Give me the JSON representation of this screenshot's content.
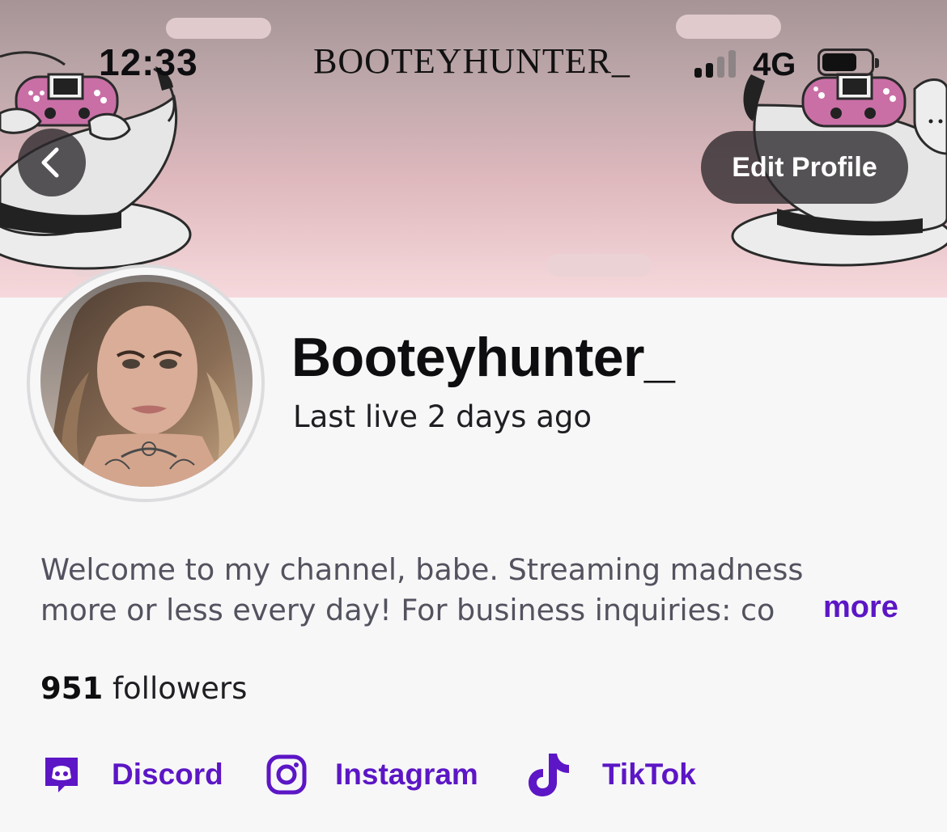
{
  "status_bar": {
    "time": "12:33",
    "title": "BOOTEYHUNTER_",
    "network": "4G",
    "signal_bars_active": 2,
    "signal_bars_total": 4
  },
  "header": {
    "edit_profile_label": "Edit Profile"
  },
  "profile": {
    "display_name": "Booteyhunter_",
    "last_live": "Last live 2 days ago",
    "bio_line1": "Welcome to my channel, babe. Streaming madness",
    "bio_line2": "more or less every day! For business inquiries: co",
    "more_label": "more",
    "follower_count": "951",
    "follower_label": "followers"
  },
  "socials": [
    {
      "label": "Discord",
      "icon": "discord-icon"
    },
    {
      "label": "Instagram",
      "icon": "instagram-icon"
    },
    {
      "label": "TikTok",
      "icon": "tiktok-icon"
    }
  ],
  "colors": {
    "accent": "#5c16c5",
    "banner_top": "#a69496",
    "banner_bottom": "#f6d9dc",
    "controller_pink": "#c96fa6",
    "background": "#f7f7f8"
  }
}
